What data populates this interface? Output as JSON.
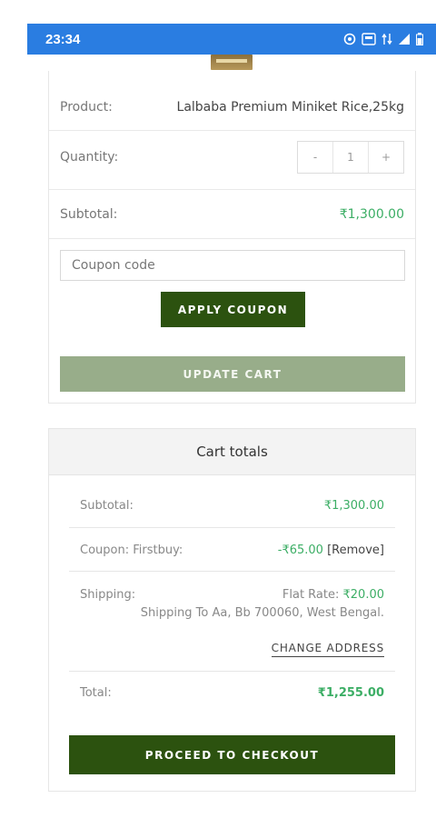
{
  "status_bar": {
    "time": "23:34"
  },
  "cart_item": {
    "product_label": "Product:",
    "product_name": "Lalbaba Premium Miniket Rice,25kg",
    "quantity_label": "Quantity:",
    "qty_minus": "-",
    "qty_value": "1",
    "qty_plus": "+",
    "subtotal_label": "Subtotal:",
    "subtotal_value": "₹1,300.00"
  },
  "coupon": {
    "placeholder": "Coupon code",
    "apply_label": "APPLY COUPON",
    "update_label": "UPDATE CART"
  },
  "cart_totals": {
    "heading": "Cart totals",
    "subtotal_label": "Subtotal:",
    "subtotal_value": "₹1,300.00",
    "coupon_label": "Coupon: Firstbuy:",
    "coupon_value": "-₹65.00",
    "coupon_remove": "[Remove]",
    "shipping_label": "Shipping:",
    "shipping_method": "Flat Rate: ",
    "shipping_value": "₹20.00",
    "shipping_destination": "Shipping To Aa, Bb 700060, West Bengal.",
    "change_address": "CHANGE ADDRESS",
    "total_label": "Total:",
    "total_value": "₹1,255.00",
    "checkout_label": "PROCEED TO CHECKOUT"
  },
  "colors": {
    "status_bar": "#2a7de1",
    "primary_button": "#2c520f",
    "disabled_button": "#98ad8a",
    "price_green": "#3cae65"
  }
}
